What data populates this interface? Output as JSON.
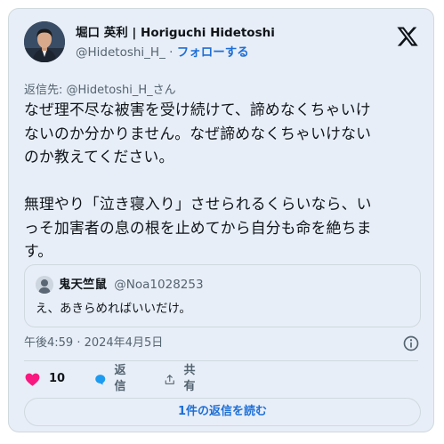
{
  "author": {
    "display_name": "堀口 英利 | Horiguchi Hidetoshi",
    "handle": "@Hidetoshi_H_",
    "separator": "·",
    "follow_label": "フォローする"
  },
  "tweet": {
    "reply_to": "返信先: @Hidetoshi_H_さん",
    "text_lines": [
      "なぜ理不尽な被害を受け続けて、諦めなくちゃいけ",
      "ないのか分かりません。なぜ諦めなくちゃいけない",
      "のか教えてください。",
      "",
      "無理やり「泣き寝入り」させられるくらいなら、い",
      "っそ加害者の息の根を止めてから自分も命を絶ちま",
      "す。"
    ],
    "timestamp": "午後4:59 · 2024年4月5日"
  },
  "quote": {
    "display_name": "鬼天竺鼠",
    "handle": "@Noa1028253",
    "text": "え、あきらめればいいだけ。"
  },
  "actions": {
    "like_count": "10",
    "reply_label": "返信",
    "share_label": "共有"
  },
  "read_replies_label": "1件の返信を読む",
  "colors": {
    "card_background": "#e8eef7",
    "link_blue": "#1d6fd8",
    "like_pink": "#f91880",
    "reply_blue": "#1d9bf0",
    "text_primary": "#0f1419",
    "text_secondary": "#536471"
  },
  "icons": {
    "brand": "x-logo-icon",
    "info": "info-icon",
    "like": "heart-icon",
    "reply": "speech-bubble-icon",
    "share": "share-upload-icon"
  }
}
